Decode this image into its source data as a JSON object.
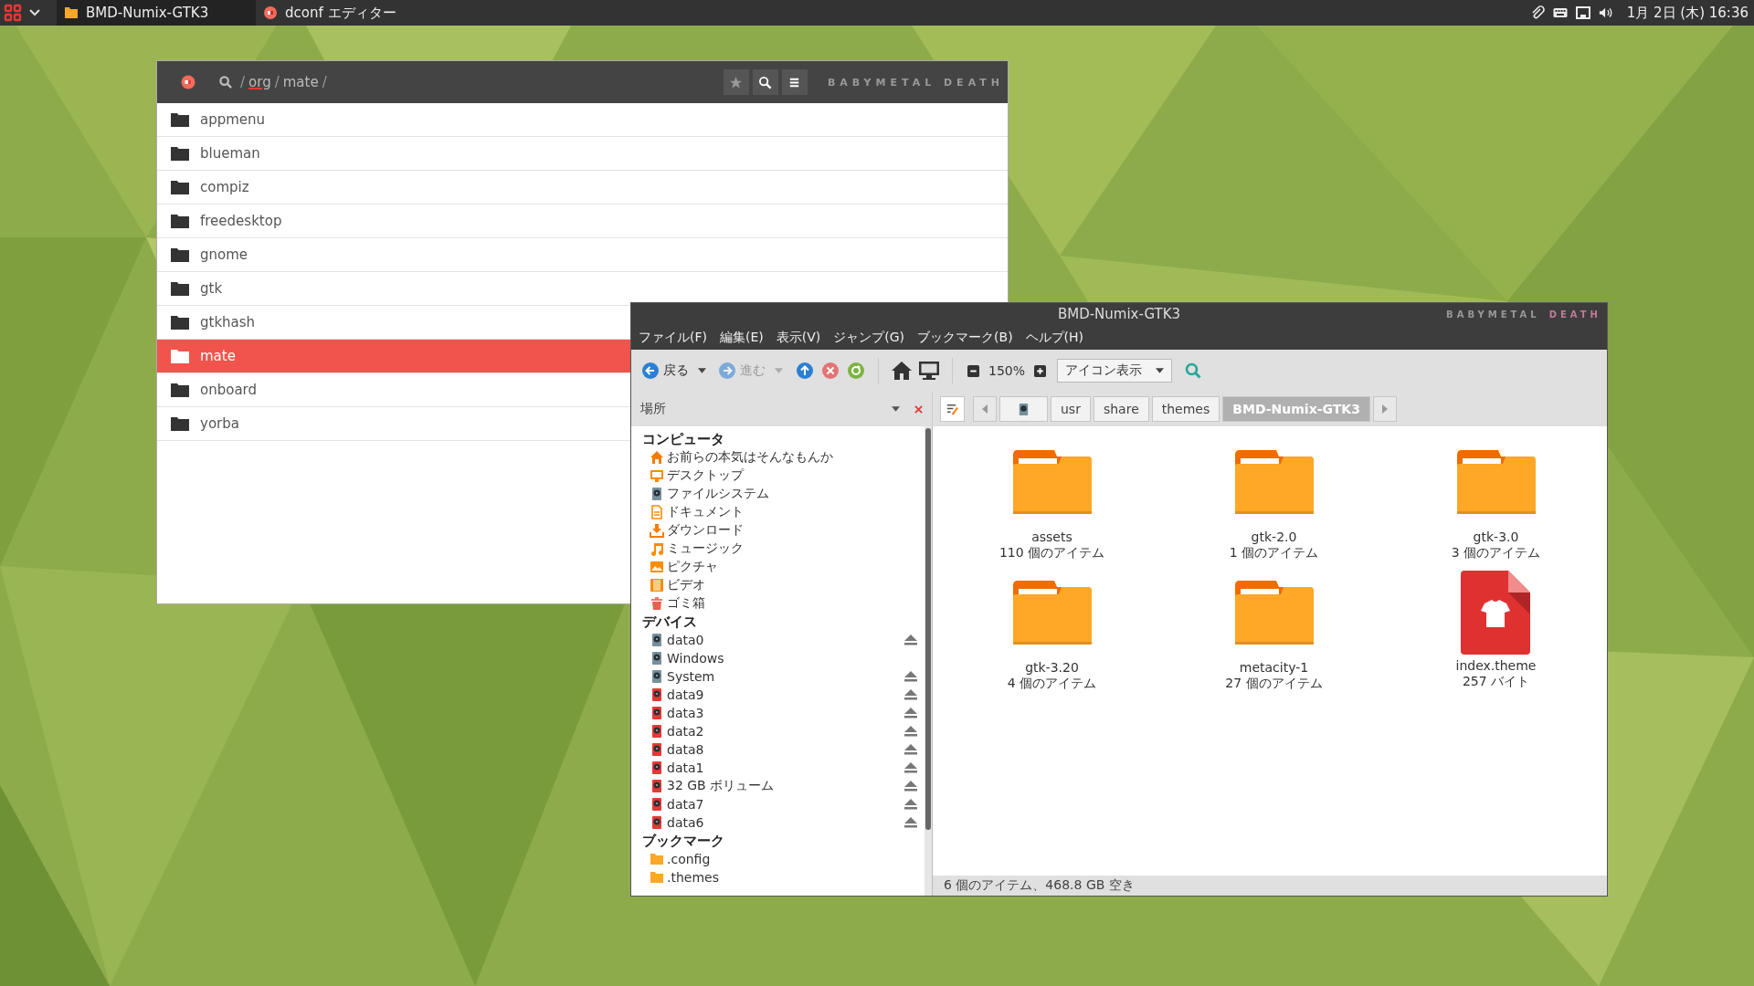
{
  "panel": {
    "tasks": [
      {
        "title": "BMD-Numix-GTK3",
        "kind": "folder",
        "selected": true
      },
      {
        "title": "dconf エディター",
        "kind": "dconf",
        "selected": false
      }
    ],
    "clock": "1月 2日 (木) 16:36"
  },
  "dconf": {
    "separator": "/",
    "path": [
      {
        "text": "org",
        "underlined": true
      },
      {
        "text": "mate",
        "underlined": false
      }
    ],
    "brand": "BABYMETAL DEATH",
    "rows": [
      {
        "name": "appmenu",
        "selected": false
      },
      {
        "name": "blueman",
        "selected": false
      },
      {
        "name": "compiz",
        "selected": false
      },
      {
        "name": "freedesktop",
        "selected": false
      },
      {
        "name": "gnome",
        "selected": false
      },
      {
        "name": "gtk",
        "selected": false
      },
      {
        "name": "gtkhash",
        "selected": false
      },
      {
        "name": "mate",
        "selected": true
      },
      {
        "name": "onboard",
        "selected": false
      },
      {
        "name": "yorba",
        "selected": false
      }
    ]
  },
  "files": {
    "title": "BMD-Numix-GTK3",
    "brand": {
      "first": "BABYMETAL",
      "second": "DEATH"
    },
    "menu": [
      "ファイル(F)",
      "編集(E)",
      "表示(V)",
      "ジャンプ(G)",
      "ブックマーク(B)",
      "ヘルプ(H)"
    ],
    "back": {
      "label": "戻る",
      "disabled": false
    },
    "forward": {
      "label": "進む",
      "disabled": true
    },
    "zoom": "150%",
    "view": "アイコン表示",
    "sidebar_title": "場所",
    "crumbs": [
      {
        "kind": "disk",
        "selected": false
      },
      {
        "kind": "text",
        "label": "usr",
        "selected": false
      },
      {
        "kind": "text",
        "label": "share",
        "selected": false
      },
      {
        "kind": "text",
        "label": "themes",
        "selected": false
      },
      {
        "kind": "text",
        "label": "BMD-Numix-GTK3",
        "selected": true
      }
    ],
    "sections": [
      {
        "title": "コンピュータ",
        "items": [
          {
            "label": "お前らの本気はそんなもんか",
            "kind": "home"
          },
          {
            "label": "デスクトップ",
            "kind": "desktop"
          },
          {
            "label": "ファイルシステム",
            "kind": "disk"
          },
          {
            "label": "ドキュメント",
            "kind": "document"
          },
          {
            "label": "ダウンロード",
            "kind": "download"
          },
          {
            "label": "ミュージック",
            "kind": "music"
          },
          {
            "label": "ピクチャ",
            "kind": "picture"
          },
          {
            "label": "ビデオ",
            "kind": "video"
          },
          {
            "label": "ゴミ箱",
            "kind": "trash"
          }
        ]
      },
      {
        "title": "デバイス",
        "items": [
          {
            "label": "data0",
            "kind": "disk",
            "eject": true
          },
          {
            "label": "Windows",
            "kind": "disk",
            "eject": false
          },
          {
            "label": "System",
            "kind": "disk",
            "eject": true
          },
          {
            "label": "data9",
            "kind": "drive",
            "eject": true
          },
          {
            "label": "data3",
            "kind": "drive",
            "eject": true
          },
          {
            "label": "data2",
            "kind": "drive",
            "eject": true
          },
          {
            "label": "data8",
            "kind": "drive",
            "eject": true
          },
          {
            "label": "data1",
            "kind": "drive",
            "eject": true
          },
          {
            "label": "32 GB ボリューム",
            "kind": "drive",
            "eject": true
          },
          {
            "label": "data7",
            "kind": "drive",
            "eject": true
          },
          {
            "label": "data6",
            "kind": "drive",
            "eject": true
          }
        ]
      },
      {
        "title": "ブックマーク",
        "items": [
          {
            "label": ".config",
            "kind": "folder"
          },
          {
            "label": ".themes",
            "kind": "folder"
          }
        ]
      }
    ],
    "items": [
      {
        "name": "assets",
        "info": "110 個のアイテム",
        "kind": "folder"
      },
      {
        "name": "gtk-2.0",
        "info": "1 個のアイテム",
        "kind": "folder"
      },
      {
        "name": "gtk-3.0",
        "info": "3 個のアイテム",
        "kind": "folder"
      },
      {
        "name": "gtk-3.20",
        "info": "4 個のアイテム",
        "kind": "folder"
      },
      {
        "name": "metacity-1",
        "info": "27 個のアイテム",
        "kind": "folder"
      },
      {
        "name": "index.theme",
        "info": "257 バイト",
        "kind": "theme"
      }
    ],
    "status": "6 個のアイテム、468.8 GB 空き"
  }
}
